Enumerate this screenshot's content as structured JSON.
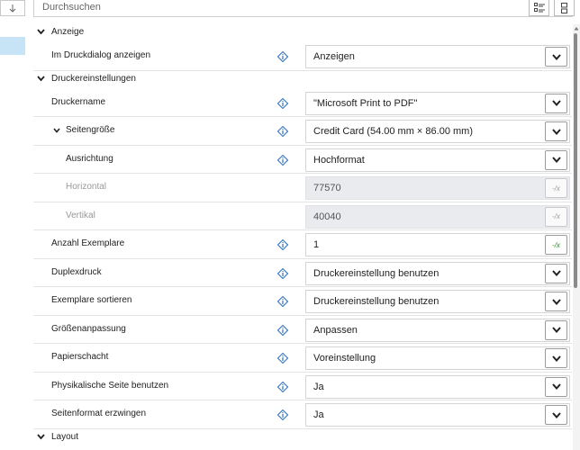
{
  "search": {
    "placeholder": "Durchsuchen"
  },
  "sections": {
    "anzeige": "Anzeige",
    "druckereinstellungen": "Druckereinstellungen",
    "layout": "Layout"
  },
  "rows": [
    {
      "label": "Im Druckdialog anzeigen",
      "value": "Anzeigen"
    },
    {
      "label": "Druckername",
      "value": "\"Microsoft Print to PDF\""
    },
    {
      "label": "Seitengröße",
      "value": "Credit Card (54.00 mm × 86.00 mm)"
    },
    {
      "label": "Ausrichtung",
      "value": "Hochformat"
    },
    {
      "label": "Horizontal",
      "value": "77570"
    },
    {
      "label": "Vertikal",
      "value": "40040"
    },
    {
      "label": "Anzahl Exemplare",
      "value": "1"
    },
    {
      "label": "Duplexdruck",
      "value": "Druckereinstellung benutzen"
    },
    {
      "label": "Exemplare sortieren",
      "value": "Druckereinstellung benutzen"
    },
    {
      "label": "Größenanpassung",
      "value": "Anpassen"
    },
    {
      "label": "Papierschacht",
      "value": "Voreinstellung"
    },
    {
      "label": "Physikalische Seite benutzen",
      "value": "Ja"
    },
    {
      "label": "Seitenformat erzwingen",
      "value": "Ja"
    }
  ],
  "colors": {
    "info_icon": "#2b6fc4",
    "selection": "#c7e4f7",
    "fx_active": "#2a8a2a"
  }
}
